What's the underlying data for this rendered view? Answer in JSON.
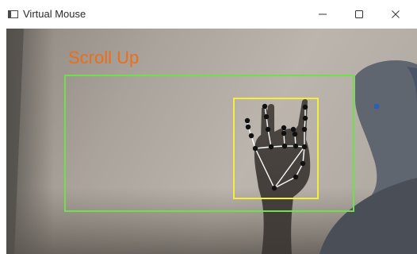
{
  "window": {
    "title": "Virtual Mouse",
    "minimize_symbol": "—",
    "maximize_icon": "square-icon",
    "close_symbol": "✕"
  },
  "overlay": {
    "gesture_text": "Scroll Up",
    "gesture_color": "#ec6e17",
    "active_region_color": "#6ee04a",
    "hand_box_color": "#f3ef3a",
    "landmark_color": "#101010",
    "skeleton_color": "#ffffff"
  }
}
